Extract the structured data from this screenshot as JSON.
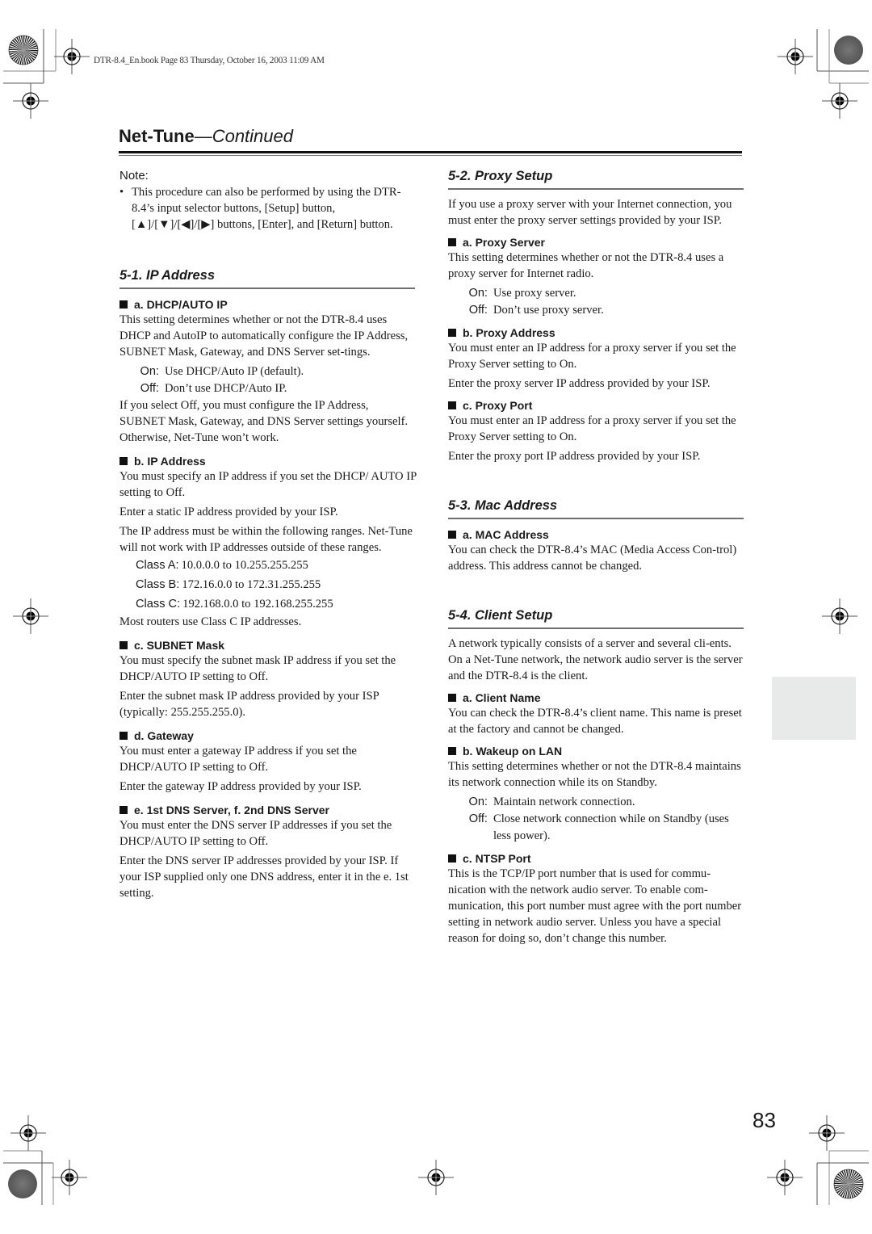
{
  "slug": "DTR-8.4_En.book  Page 83  Thursday, October 16, 2003  11:09 AM",
  "running_head": {
    "title": "Net-Tune",
    "suffix": "—Continued"
  },
  "page_number": "83",
  "icons": {
    "registration_mark": "crosshair-target-icon",
    "color_bar": "starburst-circle-icon",
    "bullet": "black-square-icon"
  },
  "colors": {
    "text": "#1a1a1a",
    "rule": "#6e6e6e",
    "thumb_tab": "#e8eaea"
  },
  "note": {
    "label": "Note:",
    "bullet": "•",
    "text": "This procedure can also be performed by using the DTR-8.4’s input selector buttons, [Setup] button, [▲]/[▼]/[◀]/[▶] buttons, [Enter], and [Return] button."
  },
  "sections": {
    "ip": {
      "title": "5-1. IP Address",
      "a": {
        "heading": "a. DHCP/AUTO IP",
        "text": "This setting determines whether or not the DTR-8.4 uses DHCP and AutoIP to automatically configure the IP Address, SUBNET Mask, Gateway, and DNS Server set-tings.",
        "options": [
          {
            "key": "On:",
            "value": "Use DHCP/Auto IP (default)."
          },
          {
            "key": "Off:",
            "value": "Don’t use DHCP/Auto IP."
          }
        ],
        "after": "If you select Off, you must configure the IP Address, SUBNET Mask, Gateway, and DNS Server settings yourself. Otherwise, Net-Tune won’t work."
      },
      "b": {
        "heading": "b. IP Address",
        "text1": "You must specify an IP address if you set the DHCP/ AUTO IP setting to Off.",
        "text2": "Enter a static IP address provided by your ISP.",
        "text3": "The IP address must be within the following ranges. Net-Tune will not work with IP addresses outside of these ranges.",
        "classes": [
          {
            "key": "Class A:",
            "value": "10.0.0.0 to 10.255.255.255"
          },
          {
            "key": "Class B:",
            "value": "172.16.0.0 to 172.31.255.255"
          },
          {
            "key": "Class C:",
            "value": "192.168.0.0 to 192.168.255.255"
          }
        ],
        "text4": "Most routers use Class C IP addresses."
      },
      "c": {
        "heading": "c. SUBNET Mask",
        "text1": "You must specify the subnet mask IP address if you set the DHCP/AUTO IP setting to Off.",
        "text2": "Enter the subnet mask IP address provided by your ISP (typically: 255.255.255.0)."
      },
      "d": {
        "heading": "d. Gateway",
        "text1": "You must enter a gateway IP address if you set the DHCP/AUTO IP setting to Off.",
        "text2": "Enter the gateway IP address provided by your ISP."
      },
      "e": {
        "heading": "e. 1st DNS Server, f. 2nd DNS Server",
        "text1": "You must enter the DNS server IP addresses if you set the DHCP/AUTO IP setting to Off.",
        "text2": "Enter the DNS server IP addresses provided by your ISP. If your ISP supplied only one DNS address, enter it in the e. 1st setting."
      }
    },
    "proxy": {
      "title": "5-2. Proxy Setup",
      "intro": "If you use a proxy server with your Internet connection, you must enter the proxy server settings provided by your ISP.",
      "a": {
        "heading": "a. Proxy Server",
        "text": "This setting determines whether or not the DTR-8.4 uses a proxy server for Internet radio.",
        "options": [
          {
            "key": "On:",
            "value": "Use proxy server."
          },
          {
            "key": "Off:",
            "value": "Don’t use proxy server."
          }
        ]
      },
      "b": {
        "heading": "b. Proxy Address",
        "text1": "You must enter an IP address for a proxy server if you set the Proxy Server setting to On.",
        "text2": "Enter the proxy server IP address provided by your ISP."
      },
      "c": {
        "heading": "c. Proxy Port",
        "text1": "You must enter an IP address for a proxy server if you set the Proxy Server setting to On.",
        "text2": "Enter the proxy port IP address provided by your ISP."
      }
    },
    "mac": {
      "title": "5-3. Mac Address",
      "a": {
        "heading": "a. MAC Address",
        "text": "You can check the DTR-8.4’s MAC (Media Access Con-trol) address. This address cannot be changed."
      }
    },
    "client": {
      "title": "5-4. Client Setup",
      "intro": "A network typically consists of a server and several cli-ents. On a Net-Tune network, the network audio server is the server and the DTR-8.4 is the client.",
      "a": {
        "heading": "a. Client Name",
        "text": "You can check the DTR-8.4’s client name. This name is preset at the factory and cannot be changed."
      },
      "b": {
        "heading": "b. Wakeup on LAN",
        "text": "This setting determines whether or not the DTR-8.4 maintains its network connection while its on Standby.",
        "options": [
          {
            "key": "On:",
            "value": "Maintain network connection."
          },
          {
            "key": "Off:",
            "value": "Close network connection while on Standby (uses less power)."
          }
        ]
      },
      "c": {
        "heading": "c. NTSP Port",
        "text": "This is the TCP/IP port number that is used for commu-nication with the network audio server. To enable com-munication, this port number must agree with the port number setting in network audio server. Unless you have a special reason for doing so, don’t change this number."
      }
    }
  }
}
